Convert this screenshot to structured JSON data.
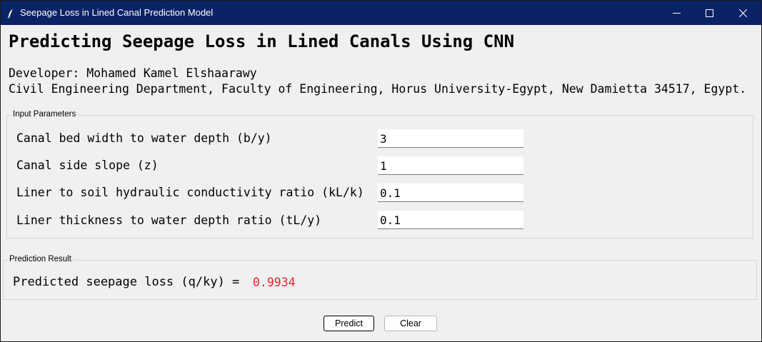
{
  "window": {
    "title": "Seepage Loss in Lined Canal Prediction Model",
    "icon": "feather-icon",
    "controls": [
      "minimize-icon",
      "maximize-icon",
      "close-icon"
    ]
  },
  "header": {
    "title": "Predicting Seepage Loss in Lined Canals Using CNN",
    "developer": "Developer: Mohamed Kamel Elshaarawy",
    "affiliation": "Civil Engineering Department, Faculty of Engineering, Horus University-Egypt, New Damietta 34517, Egypt."
  },
  "inputs": {
    "group_label": "Input Parameters",
    "params": [
      {
        "label": "Canal bed width to water depth (b/y)",
        "value": "3"
      },
      {
        "label": "Canal side slope (z)",
        "value": "1"
      },
      {
        "label": "Liner to soil hydraulic conductivity ratio (kL/k)",
        "value": "0.1"
      },
      {
        "label": "Liner thickness to water depth ratio (tL/y)",
        "value": "0.1"
      }
    ]
  },
  "result": {
    "group_label": "Prediction Result",
    "label": "Predicted seepage loss (q/ky) =",
    "value": "0.9934",
    "value_color": "#e8262e"
  },
  "buttons": {
    "predict": "Predict",
    "clear": "Clear"
  },
  "colors": {
    "titlebar": "#0a2266",
    "window_bg": "#f0f0f0"
  }
}
